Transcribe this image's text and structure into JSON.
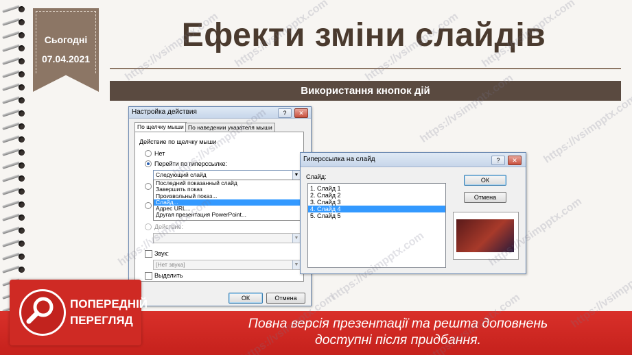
{
  "date_ribbon": {
    "label": "Сьогодні",
    "date": "07.04.2021"
  },
  "slide": {
    "title": "Ефекти зміни слайдів",
    "subtitle": "Використання кнопок дій"
  },
  "action_dialog": {
    "title": "Настройка действия",
    "tabs": [
      "По щелчку мыши",
      "По наведении указателя мыши"
    ],
    "group_label": "Действие по щелчку мыши",
    "options": {
      "none": "Нет",
      "hyperlink": "Перейти по гиперссылке:",
      "run_macro": "Действие:",
      "sound": "Звук:",
      "highlight": "Выделить"
    },
    "hyperlink_value": "Следующий слайд",
    "hyperlink_list": [
      "Последний показанный слайд",
      "Завершить показ",
      "Произвольный показ...",
      "Слайд...",
      "Адрес URL...",
      "Другая презентация PowerPoint..."
    ],
    "sound_value": "[Нет звука]",
    "ok": "ОК",
    "cancel": "Отмена",
    "help": "?",
    "close": "✕"
  },
  "hyperlink_dialog": {
    "title": "Гиперссылка на слайд",
    "list_label": "Слайд:",
    "slides": [
      "1. Слайд 1",
      "2. Слайд 2",
      "3. Слайд 3",
      "4. Слайд 4",
      "5. Слайд 5"
    ],
    "selected_index": 3,
    "ok": "ОК",
    "cancel": "Отмена",
    "help": "?",
    "close": "✕"
  },
  "preview_badge": {
    "line1": "ПОПЕРЕДНІЙ",
    "line2": "ПЕРЕГЛЯД"
  },
  "footer": {
    "line1": "Повна версія презентації та решта доповнень",
    "line2": "доступні після придбання."
  },
  "watermark": "https://vsimpptx.com",
  "colors": {
    "accent": "#8c7665",
    "title": "#4a3a2e",
    "bar": "#5a4a40",
    "footer": "#cf2a24",
    "selection": "#3399ff"
  }
}
